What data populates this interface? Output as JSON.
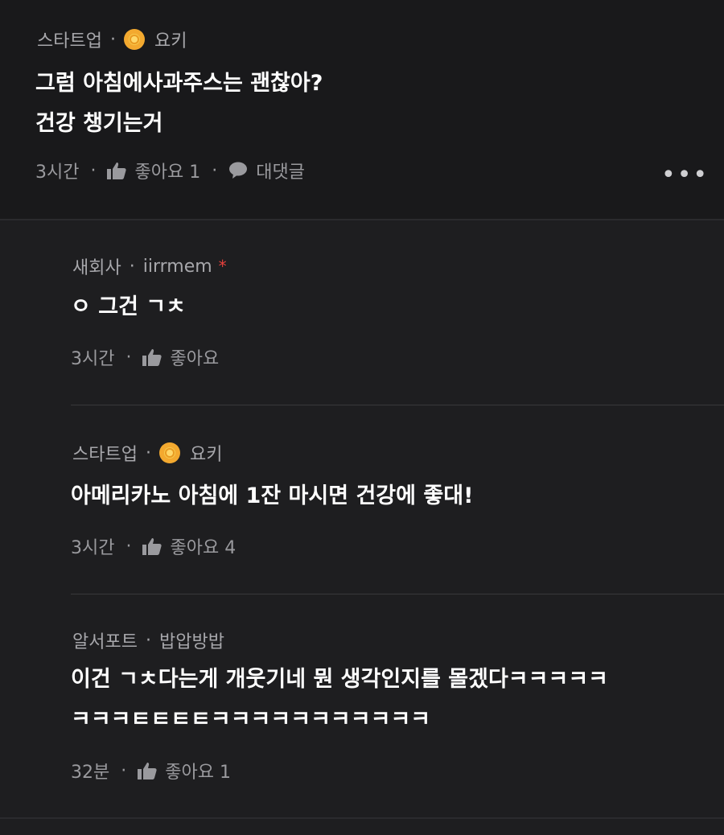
{
  "comments": [
    {
      "company": "스타트업",
      "author": "요키",
      "has_badge": true,
      "lines": [
        "그럼 아침에사과주스는 괜찮아?",
        "건강 챙기는거"
      ],
      "time": "3시간",
      "like_label": "좋아요 1",
      "reply_label": "대댓글",
      "more": "•••"
    },
    {
      "company": "새회사",
      "author": "iirrmem",
      "op_marker": "*",
      "lines": [
        "ㅇ 그건 ㄱㅊ"
      ],
      "time": "3시간",
      "like_label": "좋아요"
    },
    {
      "company": "스타트업",
      "author": "요키",
      "has_badge": true,
      "lines": [
        "아메리카노 아침에 1잔 마시면 건강에 좋대!"
      ],
      "time": "3시간",
      "like_label": "좋아요 4"
    },
    {
      "company": "알서포트",
      "author": "밥압방밥",
      "lines": [
        "이건 ㄱㅊ다는게 개웃기네 뭔 생각인지를 몰겠다ㅋㅋㅋㅋㅋ",
        "ㅋㅋㅋㅌㅌㅌㅌㅋㅋㅋㅋㅋㅋㅋㅋㅋㅋㅋ"
      ],
      "time": "32분",
      "like_label": "좋아요 1"
    }
  ],
  "separator": "·",
  "colors": {
    "background": "#1e1e20",
    "top_background": "#19191b",
    "meta_text": "#a7a7ab",
    "body_text": "#ffffff",
    "op_marker": "#e8413c",
    "badge": "#f3a92f"
  }
}
